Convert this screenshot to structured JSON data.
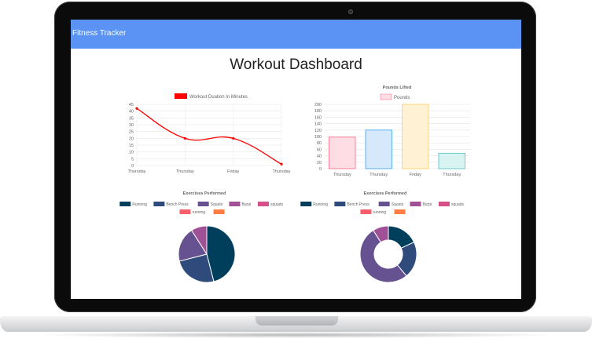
{
  "app": {
    "brand": "Fitness Tracker",
    "page_title": "Workout Dashboard"
  },
  "colors": {
    "navbar": "#5b93f5"
  },
  "charts": {
    "duration": {
      "chart_data": {
        "type": "line",
        "legend": "Workout Duation In Minutes",
        "legend_color": "#ff0000",
        "categories": [
          "Thursday",
          "Thursday",
          "Friday",
          "Thursday"
        ],
        "series": [
          {
            "name": "Workout Duation In Minutes",
            "values": [
              42,
              20,
              20,
              1
            ],
            "color": "#ff0000"
          }
        ],
        "ylim": [
          0,
          45
        ],
        "yticks": [
          "45",
          "40",
          "35",
          "30",
          "25",
          "20",
          "15",
          "10",
          "5",
          "0"
        ],
        "grid": true
      }
    },
    "pounds": {
      "chart_data": {
        "type": "bar",
        "title": "Pounds Lifted",
        "legend": "Pounds",
        "categories": [
          "Thursday",
          "Thursday",
          "Friday",
          "Thursday"
        ],
        "values": [
          98,
          120,
          200,
          48
        ],
        "fills": [
          "#ffdde4",
          "#d6e8fb",
          "#fff1d4",
          "#d9f2f2"
        ],
        "strokes": [
          "#ff6384",
          "#36a2eb",
          "#ffce56",
          "#4bc0c0"
        ],
        "ylim": [
          0,
          200
        ],
        "yticks": [
          "200",
          "180",
          "160",
          "140",
          "120",
          "100",
          "80",
          "60",
          "40",
          "20",
          "0"
        ],
        "grid": true
      }
    },
    "exercises_pie": {
      "chart_data": {
        "type": "pie",
        "title": "Exercises Performed",
        "legend": [
          {
            "label": "Running",
            "color": "#003f5c"
          },
          {
            "label": "Bench Press",
            "color": "#2f4b7c"
          },
          {
            "label": "Squats",
            "color": "#665191"
          },
          {
            "label": "Burpi",
            "color": "#a05195"
          },
          {
            "label": "squads",
            "color": "#d45087"
          },
          {
            "label": "running",
            "color": "#f95d6a"
          },
          {
            "label": "",
            "color": "#ff7c43"
          }
        ],
        "values": [
          46,
          25,
          20,
          9,
          0,
          0,
          0
        ]
      }
    },
    "exercises_donut": {
      "chart_data": {
        "type": "pie",
        "subtype": "doughnut",
        "title": "Exercises Performed",
        "legend": [
          {
            "label": "Running",
            "color": "#003f5c"
          },
          {
            "label": "Bench Press",
            "color": "#2f4b7c"
          },
          {
            "label": "Squats",
            "color": "#665191"
          },
          {
            "label": "Burpi",
            "color": "#a05195"
          },
          {
            "label": "squads",
            "color": "#d45087"
          },
          {
            "label": "running",
            "color": "#f95d6a"
          },
          {
            "label": "",
            "color": "#ff7c43"
          }
        ],
        "values": [
          18,
          21,
          52,
          9,
          0,
          0,
          0
        ]
      }
    }
  }
}
